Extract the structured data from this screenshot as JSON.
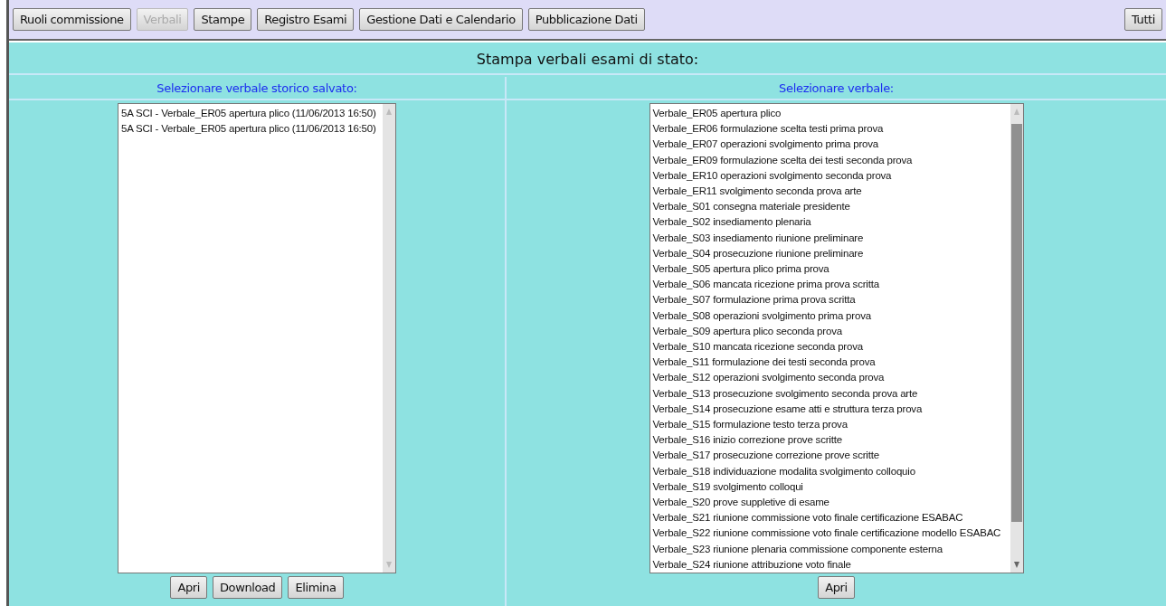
{
  "toolbar": {
    "buttons": [
      {
        "label": "Ruoli commissione",
        "disabled": false
      },
      {
        "label": "Verbali",
        "disabled": true
      },
      {
        "label": "Stampe",
        "disabled": false
      },
      {
        "label": "Registro Esami",
        "disabled": false
      },
      {
        "label": "Gestione Dati e Calendario",
        "disabled": false
      },
      {
        "label": "Pubblicazione Dati",
        "disabled": false
      }
    ],
    "right_button": {
      "label": "Tutti",
      "disabled": false
    }
  },
  "title": "Stampa verbali esami di stato:",
  "panels": [
    {
      "header": "Selezionare verbale storico salvato:",
      "items": [
        "5A SCI - Verbale_ER05 apertura plico (11/06/2013 16:50)",
        "5A SCI - Verbale_ER05 apertura plico (11/06/2013 16:50)"
      ],
      "buttons": [
        "Apri",
        "Download",
        "Elimina"
      ]
    },
    {
      "header": "Selezionare verbale:",
      "items": [
        "Verbale_ER05 apertura plico",
        "Verbale_ER06 formulazione scelta testi prima prova",
        "Verbale_ER07 operazioni svolgimento prima prova",
        "Verbale_ER09 formulazione scelta dei testi seconda prova",
        "Verbale_ER10 operazioni svolgimento seconda prova",
        "Verbale_ER11 svolgimento seconda prova arte",
        "Verbale_S01 consegna materiale presidente",
        "Verbale_S02 insediamento plenaria",
        "Verbale_S03 insediamento riunione preliminare",
        "Verbale_S04 prosecuzione riunione preliminare",
        "Verbale_S05 apertura plico prima prova",
        "Verbale_S06 mancata ricezione prima prova scritta",
        "Verbale_S07 formulazione prima prova scritta",
        "Verbale_S08 operazioni svolgimento prima prova",
        "Verbale_S09 apertura plico seconda prova",
        "Verbale_S10 mancata ricezione seconda prova",
        "Verbale_S11 formulazione dei testi seconda prova",
        "Verbale_S12 operazioni svolgimento seconda prova",
        "Verbale_S13 prosecuzione svolgimento seconda prova arte",
        "Verbale_S14 prosecuzione esame atti e struttura terza prova",
        "Verbale_S15 formulazione testo terza prova",
        "Verbale_S16 inizio correzione prove scritte",
        "Verbale_S17 prosecuzione correzione prove scritte",
        "Verbale_S18 individuazione modalita svolgimento colloquio",
        "Verbale_S19 svolgimento colloqui",
        "Verbale_S20 prove suppletive di esame",
        "Verbale_S21 riunione commissione voto finale certificazione ESABAC",
        "Verbale_S22 riunione commissione voto finale certificazione modello ESABAC",
        "Verbale_S23 riunione plenaria commissione componente esterna",
        "Verbale_S24 riunione attribuzione voto finale"
      ],
      "buttons": [
        "Apri"
      ]
    }
  ]
}
